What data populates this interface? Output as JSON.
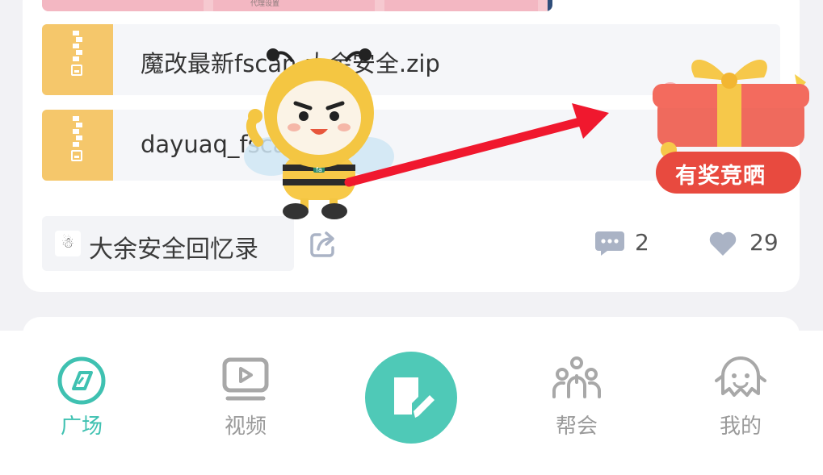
{
  "files": [
    {
      "name": "魔改最新fscan-大余安全.zip",
      "icon": "zip-icon"
    },
    {
      "name": "dayuaq_fscan.zip",
      "icon": "zip-icon"
    }
  ],
  "thumb_caption": "代理设置",
  "post": {
    "tag": "大余安全回忆录",
    "avatar_glyph": "☃",
    "comments": "2",
    "likes": "29"
  },
  "promo": {
    "label": "有奖竞晒",
    "mascot_badge": "fa"
  },
  "tabbar": {
    "tabs": [
      {
        "label": "广场",
        "icon": "square-icon",
        "active": true
      },
      {
        "label": "视频",
        "icon": "video-icon",
        "active": false
      },
      {
        "label": "帮会",
        "icon": "group-icon",
        "active": false
      },
      {
        "label": "我的",
        "icon": "ghost-icon",
        "active": false
      }
    ],
    "compose_icon": "compose-icon"
  },
  "colors": {
    "accent": "#3fc1b1",
    "zip_yellow": "#f5c76b",
    "arrow_red": "#f0182e",
    "promo_red": "#e84a3f"
  }
}
